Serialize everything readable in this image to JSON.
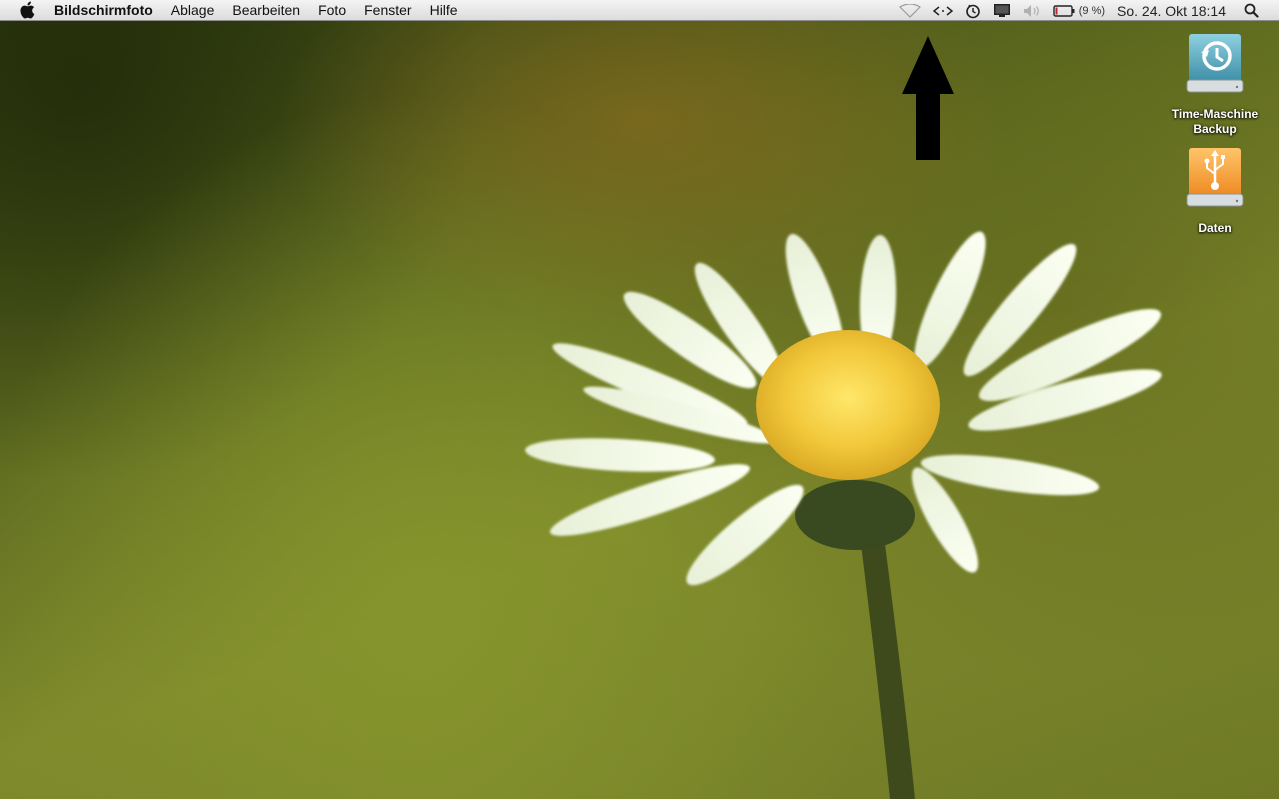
{
  "menubar": {
    "app_name": "Bildschirmfoto",
    "items": [
      "Ablage",
      "Bearbeiten",
      "Foto",
      "Fenster",
      "Hilfe"
    ],
    "status": {
      "icons": [
        "wifi-icon",
        "network-arrows-icon",
        "time-machine-icon",
        "display-icon",
        "volume-icon",
        "battery-icon",
        "spotlight-icon"
      ],
      "battery_percent": "(9 %)",
      "clock": "So. 24. Okt  18:14"
    }
  },
  "desktop": {
    "icons": [
      {
        "name": "time-machine-backup",
        "label_line1": "Time-Maschine",
        "label_line2": "Backup",
        "icon": "time-machine-drive-icon",
        "color": "#5fb0c8"
      },
      {
        "name": "daten",
        "label_line1": "Daten",
        "label_line2": "",
        "icon": "usb-drive-icon",
        "color": "#f0a040"
      }
    ]
  },
  "annotation": {
    "icon": "up-arrow-icon",
    "color": "#000000"
  }
}
